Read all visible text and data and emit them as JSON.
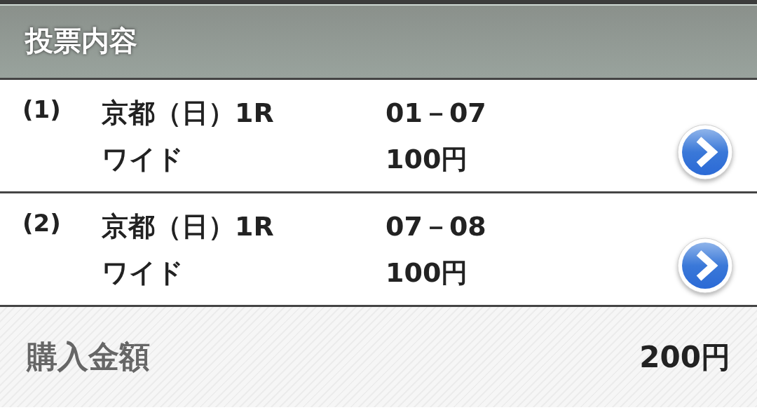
{
  "header": {
    "title": "投票内容"
  },
  "bets": [
    {
      "number": "(1)",
      "race": "京都（日）1R",
      "type": "ワイド",
      "combination": "01－07",
      "amount": "100円"
    },
    {
      "number": "(2)",
      "race": "京都（日）1R",
      "type": "ワイド",
      "combination": "07－08",
      "amount": "100円"
    }
  ],
  "total": {
    "label": "購入金額",
    "amount": "200円"
  }
}
